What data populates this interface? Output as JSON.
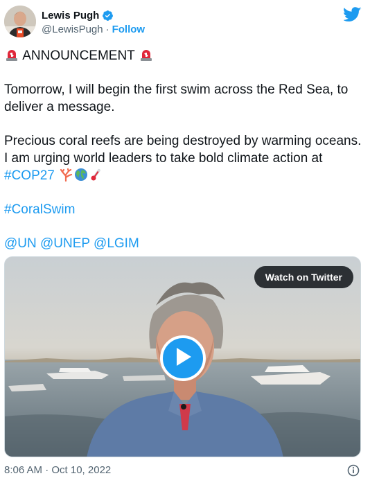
{
  "author": {
    "name": "Lewis Pugh",
    "handle": "@LewisPugh",
    "separator": "·",
    "follow_label": "Follow"
  },
  "tweet": {
    "announcement": "ANNOUNCEMENT",
    "paragraph1": "Tomorrow, I will begin the first swim across the Red Sea, to deliver a message.",
    "paragraph2_text": "Precious coral reefs are being destroyed by warming oceans. I am urging world leaders to take bold climate action at",
    "hashtag_cop": "#COP27",
    "hashtag_coralswim": "#CoralSwim",
    "mentions": [
      "@UN",
      "@UNEP",
      "@LGIM"
    ]
  },
  "media": {
    "watch_label": "Watch on Twitter"
  },
  "footer": {
    "timestamp": "8:06 AM · Oct 10, 2022"
  },
  "icons": {
    "verified": "verified-badge-icon",
    "twitter": "twitter-bird-icon",
    "siren": "rotating-light-icon",
    "coral": "coral-icon",
    "globe": "globe-icon",
    "thermometer": "thermometer-icon",
    "play": "play-icon",
    "info": "info-icon"
  },
  "colors": {
    "brand_blue": "#1d9bf0",
    "text": "#0f1419",
    "secondary": "#536471"
  }
}
